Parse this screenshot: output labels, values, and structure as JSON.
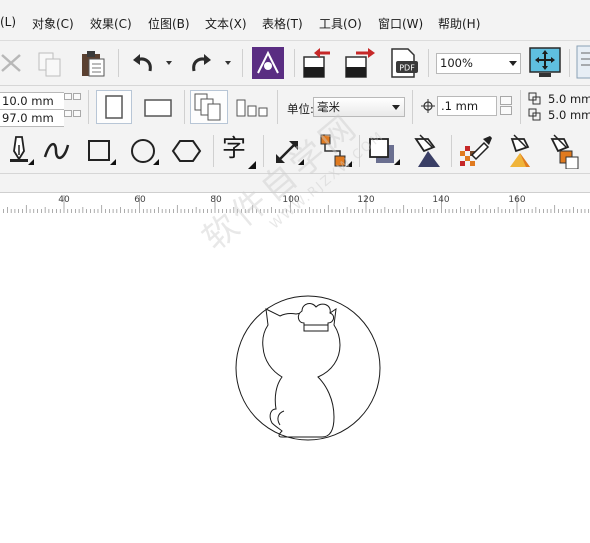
{
  "menu": [
    {
      "label": "(L)"
    },
    {
      "label": "对象(C)"
    },
    {
      "label": "效果(C)"
    },
    {
      "label": "位图(B)"
    },
    {
      "label": "文本(X)"
    },
    {
      "label": "表格(T)"
    },
    {
      "label": "工具(O)"
    },
    {
      "label": "窗口(W)"
    },
    {
      "label": "帮助(H)"
    }
  ],
  "toolbar": {
    "zoom_value": "100%",
    "icons": [
      "cut-icon",
      "copy-icon",
      "paste-icon",
      "undo-icon",
      "redo-icon",
      "corel-connect-icon",
      "import-icon",
      "export-icon",
      "publish-pdf-icon",
      "full-screen-icon",
      "options-icon"
    ]
  },
  "property_bar": {
    "width_value": "10.0 mm",
    "height_value": "97.0 mm",
    "units_label": "单位:",
    "units_value": "毫米",
    "nudge_value": ".1 mm",
    "dup_x_value": "5.0 mm",
    "dup_y_value": "5.0 mm"
  },
  "toolbox": {
    "tools": [
      "pen-tool-icon",
      "curve-tool-icon",
      "rectangle-tool-icon",
      "ellipse-tool-icon",
      "polygon-tool-icon",
      "text-tool-icon",
      "dimension-tool-icon",
      "connector-tool-icon",
      "drop-shadow-tool-icon",
      "transparency-tool-icon",
      "color-eyedropper-icon",
      "eyedropper-tool-icon",
      "fill-tool-icon",
      "interactive-fill-icon"
    ],
    "text_tool_glyph": "字"
  },
  "ruler": {
    "labels": [
      "40",
      "60",
      "80",
      "100",
      "120",
      "140",
      "160"
    ]
  },
  "watermark": {
    "text": "软件自学网",
    "subtext": "WWW.RJZXW.COM"
  },
  "colors": {
    "chrome_bg": "#f3f3f3",
    "canvas_bg": "#ffffff",
    "accent_orange": "#e07a1f",
    "accent_purple": "#5a2d82",
    "accent_red": "#c62828"
  }
}
